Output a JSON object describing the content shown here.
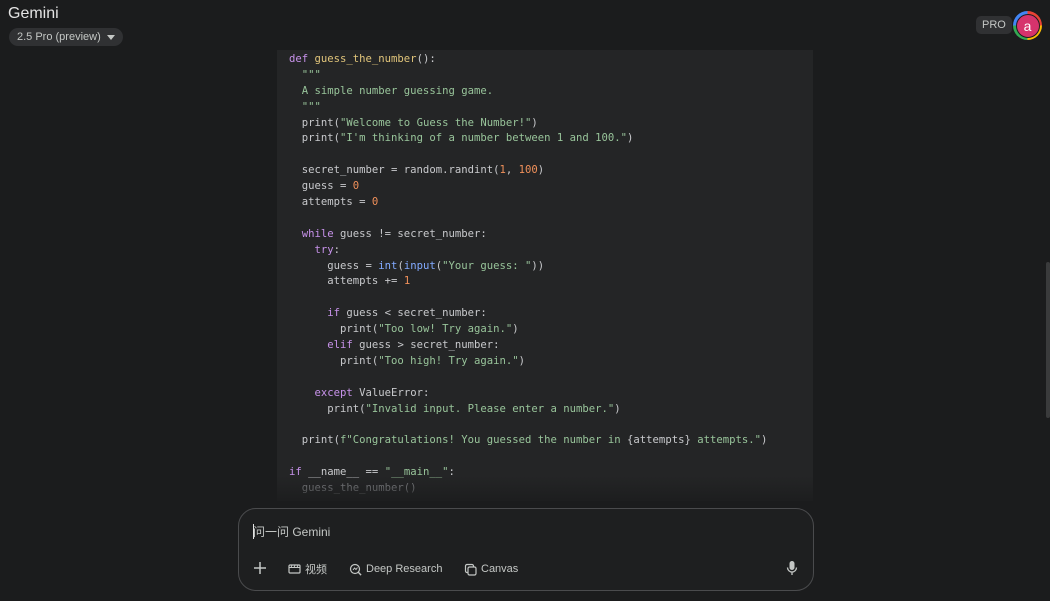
{
  "header": {
    "app_title": "Gemini",
    "model_selector": "2.5 Pro (preview)",
    "pro_badge": "PRO",
    "avatar_letter": "a"
  },
  "code": {
    "lines": [
      [
        [
          "kw",
          "def "
        ],
        [
          "fn",
          "guess_the_number"
        ],
        [
          "plain",
          "():"
        ]
      ],
      [
        [
          "str",
          "  \"\"\""
        ]
      ],
      [
        [
          "str",
          "  A simple number guessing game."
        ]
      ],
      [
        [
          "str",
          "  \"\"\""
        ]
      ],
      [
        [
          "plain",
          "  print("
        ],
        [
          "str",
          "\"Welcome to Guess the Number!\""
        ],
        [
          "plain",
          ")"
        ]
      ],
      [
        [
          "plain",
          "  print("
        ],
        [
          "str",
          "\"I'm thinking of a number between 1 and 100.\""
        ],
        [
          "plain",
          ")"
        ]
      ],
      [
        [
          "plain",
          ""
        ]
      ],
      [
        [
          "plain",
          "  secret_number = random.randint("
        ],
        [
          "num",
          "1"
        ],
        [
          "plain",
          ", "
        ],
        [
          "num",
          "100"
        ],
        [
          "plain",
          ")"
        ]
      ],
      [
        [
          "plain",
          "  guess = "
        ],
        [
          "num",
          "0"
        ]
      ],
      [
        [
          "plain",
          "  attempts = "
        ],
        [
          "num",
          "0"
        ]
      ],
      [
        [
          "plain",
          ""
        ]
      ],
      [
        [
          "kw",
          "  while "
        ],
        [
          "plain",
          "guess != secret_number:"
        ]
      ],
      [
        [
          "kw",
          "    try"
        ],
        [
          "plain",
          ":"
        ]
      ],
      [
        [
          "plain",
          "      guess = "
        ],
        [
          "bi",
          "int"
        ],
        [
          "plain",
          "("
        ],
        [
          "bi",
          "input"
        ],
        [
          "plain",
          "("
        ],
        [
          "str",
          "\"Your guess: \""
        ],
        [
          "plain",
          "))"
        ]
      ],
      [
        [
          "plain",
          "      attempts += "
        ],
        [
          "num",
          "1"
        ]
      ],
      [
        [
          "plain",
          ""
        ]
      ],
      [
        [
          "kw",
          "      if "
        ],
        [
          "plain",
          "guess < secret_number:"
        ]
      ],
      [
        [
          "plain",
          "        print("
        ],
        [
          "str",
          "\"Too low! Try again.\""
        ],
        [
          "plain",
          ")"
        ]
      ],
      [
        [
          "kw",
          "      elif "
        ],
        [
          "plain",
          "guess > secret_number:"
        ]
      ],
      [
        [
          "plain",
          "        print("
        ],
        [
          "str",
          "\"Too high! Try again.\""
        ],
        [
          "plain",
          ")"
        ]
      ],
      [
        [
          "plain",
          ""
        ]
      ],
      [
        [
          "kw",
          "    except "
        ],
        [
          "plain",
          "ValueError:"
        ]
      ],
      [
        [
          "plain",
          "      print("
        ],
        [
          "str",
          "\"Invalid input. Please enter a number.\""
        ],
        [
          "plain",
          ")"
        ]
      ],
      [
        [
          "plain",
          ""
        ]
      ],
      [
        [
          "plain",
          "  print("
        ],
        [
          "str",
          "f\"Congratulations! You guessed the number in "
        ],
        [
          "plain",
          "{attempts}"
        ],
        [
          "str",
          " attempts.\""
        ],
        [
          "plain",
          ")"
        ]
      ],
      [
        [
          "plain",
          ""
        ]
      ],
      [
        [
          "kw",
          "if "
        ],
        [
          "plain",
          "__name__ == "
        ],
        [
          "str",
          "\"__main__\""
        ],
        [
          "plain",
          ":"
        ]
      ],
      [
        [
          "dim",
          "  guess_the_number()"
        ]
      ]
    ]
  },
  "composer": {
    "placeholder": "问一问 Gemini",
    "tools": {
      "video_label": "视频",
      "deep_research_label": "Deep Research",
      "canvas_label": "Canvas"
    },
    "icons": [
      "plus-icon",
      "video-icon",
      "deep-research-icon",
      "canvas-icon",
      "microphone-icon"
    ]
  },
  "colors": {
    "background": "#1b1c1d",
    "code_background": "#242526",
    "keyword": "#c792ea",
    "function": "#e0c47a",
    "string": "#98c49a",
    "number": "#f0905a",
    "avatar": "#d6336c"
  }
}
